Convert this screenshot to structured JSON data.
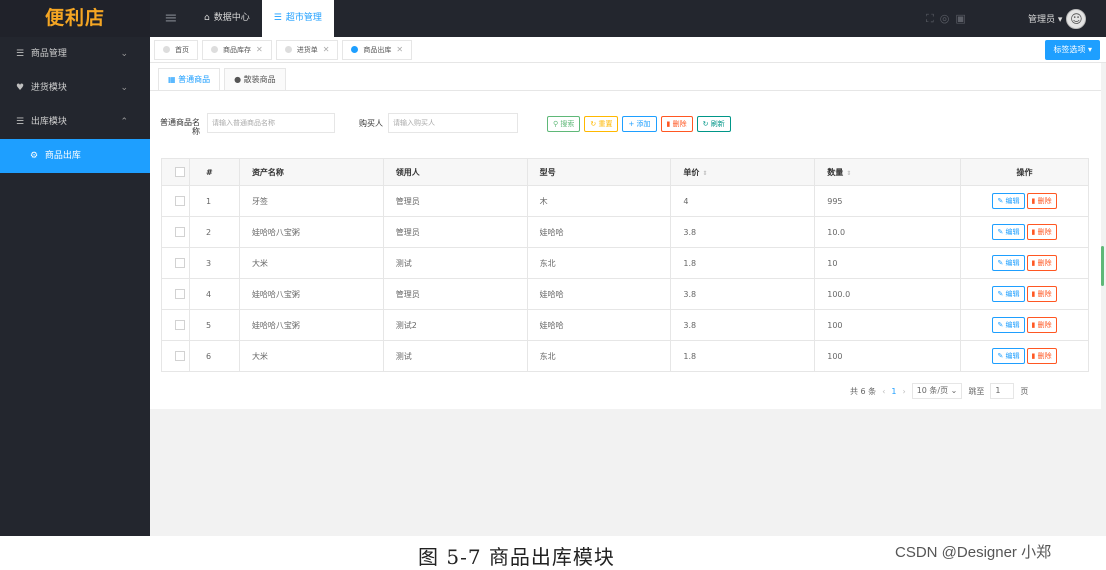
{
  "app": {
    "logo": "便利店"
  },
  "topbar": {
    "nav": [
      {
        "icon": "home-icon",
        "label": "数据中心"
      },
      {
        "icon": "list-icon",
        "label": "超市管理"
      }
    ],
    "user_label": "管理员 ▾"
  },
  "sidebar": {
    "items": [
      {
        "label": "商品管理",
        "icon": "list-icon",
        "arrow": "⌄"
      },
      {
        "label": "进货模块",
        "icon": "cart-icon",
        "arrow": "⌄"
      },
      {
        "label": "出库模块",
        "icon": "list-icon",
        "arrow": "⌃"
      }
    ],
    "sub_items": [
      {
        "label": "商品出库",
        "icon": "gear-icon"
      }
    ]
  },
  "tabs": {
    "items": [
      {
        "label": "首页"
      },
      {
        "label": "商品库存"
      },
      {
        "label": "进货单"
      },
      {
        "label": "商品出库"
      }
    ],
    "options_label": "标签选项 ▾"
  },
  "subtabs": [
    "普通商品",
    "散装商品"
  ],
  "search": {
    "label1": "普通商品名称",
    "placeholder1": "请输入普通商品名称",
    "label2": "购买人",
    "placeholder2": "请输入购买人"
  },
  "buttons": {
    "search": "搜索",
    "reset": "重置",
    "add": "添加",
    "delete": "删除",
    "refresh": "刷新"
  },
  "table": {
    "headers": [
      "#",
      "资产名称",
      "领用人",
      "型号",
      "单价",
      "数量",
      "操作"
    ],
    "rows": [
      [
        "1",
        "牙签",
        "管理员",
        "木",
        "4",
        "995"
      ],
      [
        "2",
        "娃哈哈八宝粥",
        "管理员",
        "娃哈哈",
        "3.8",
        "10.0"
      ],
      [
        "3",
        "大米",
        "测试",
        "东北",
        "1.8",
        "10"
      ],
      [
        "4",
        "娃哈哈八宝粥",
        "管理员",
        "娃哈哈",
        "3.8",
        "100.0"
      ],
      [
        "5",
        "娃哈哈八宝粥",
        "测试2",
        "娃哈哈",
        "3.8",
        "100"
      ],
      [
        "6",
        "大米",
        "测试",
        "东北",
        "1.8",
        "100"
      ]
    ],
    "edit_label": "编辑",
    "delete_label": "删除"
  },
  "pager": {
    "total": "共 6 条",
    "current": "1",
    "page_size": "10 条/页 ⌄",
    "jump_label": "跳至",
    "jump_value": "1",
    "page_suffix": "页"
  },
  "caption": {
    "text": "图  5-7    商品出库模块",
    "watermark": "CSDN @Designer 小郑"
  }
}
